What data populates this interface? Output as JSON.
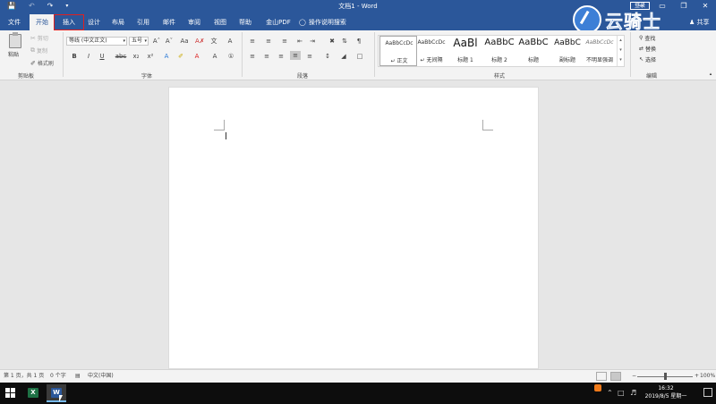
{
  "window": {
    "title": "文档1 - Word",
    "login_label": "登录",
    "share_label": "共享",
    "controls": [
      "─",
      "▭",
      "❐",
      "✕"
    ]
  },
  "quick_access": {
    "save_icon": "save-icon",
    "undo_icon": "undo-icon",
    "redo_icon": "redo-icon",
    "customize_icon": "dropdown-icon"
  },
  "tabs": [
    {
      "label": "文件"
    },
    {
      "label": "开始"
    },
    {
      "label": "插入"
    },
    {
      "label": "设计"
    },
    {
      "label": "布局"
    },
    {
      "label": "引用"
    },
    {
      "label": "邮件"
    },
    {
      "label": "审阅"
    },
    {
      "label": "视图"
    },
    {
      "label": "帮助"
    },
    {
      "label": "金山PDF"
    }
  ],
  "active_tab": "开始",
  "highlighted_tab": "插入",
  "tell_me": "操作说明搜索",
  "watermark": "云骑士",
  "clipboard": {
    "paste": "粘贴",
    "cut": "剪切",
    "copy": "复制",
    "format_painter": "格式刷",
    "group_label": "剪贴板"
  },
  "font": {
    "font_name": "等线 (中文正文)",
    "font_size": "五号",
    "group_label": "字体",
    "bold": "B",
    "italic": "I",
    "underline": "U",
    "strike": "abc",
    "subscript": "x₂",
    "superscript": "x²"
  },
  "paragraph": {
    "group_label": "段落"
  },
  "styles": {
    "group_label": "样式",
    "items": [
      {
        "sample": "AaBbCcDc",
        "name": "↵ 正文"
      },
      {
        "sample": "AaBbCcDc",
        "name": "↵ 无间隔"
      },
      {
        "sample": "AaBl",
        "name": "标题 1"
      },
      {
        "sample": "AaBbC",
        "name": "标题 2"
      },
      {
        "sample": "AaBbC",
        "name": "标题"
      },
      {
        "sample": "AaBbC",
        "name": "副标题"
      },
      {
        "sample": "AaBbCcDc",
        "name": "不明显强调"
      }
    ]
  },
  "editing": {
    "find": "查找",
    "replace": "替换",
    "select": "选择",
    "group_label": "编辑"
  },
  "status_bar": {
    "page": "第 1 页，共 1 页",
    "words": "0 个字",
    "language": "中文(中国)",
    "zoom": "100%",
    "zoom_level": 1.0
  },
  "taskbar": {
    "time": "16:32",
    "date": "2019/8/5 星期一",
    "excel_letter": "X",
    "word_letter": "W"
  },
  "colors": {
    "accent": "#2b579a",
    "highlight_box": "#e02020"
  }
}
